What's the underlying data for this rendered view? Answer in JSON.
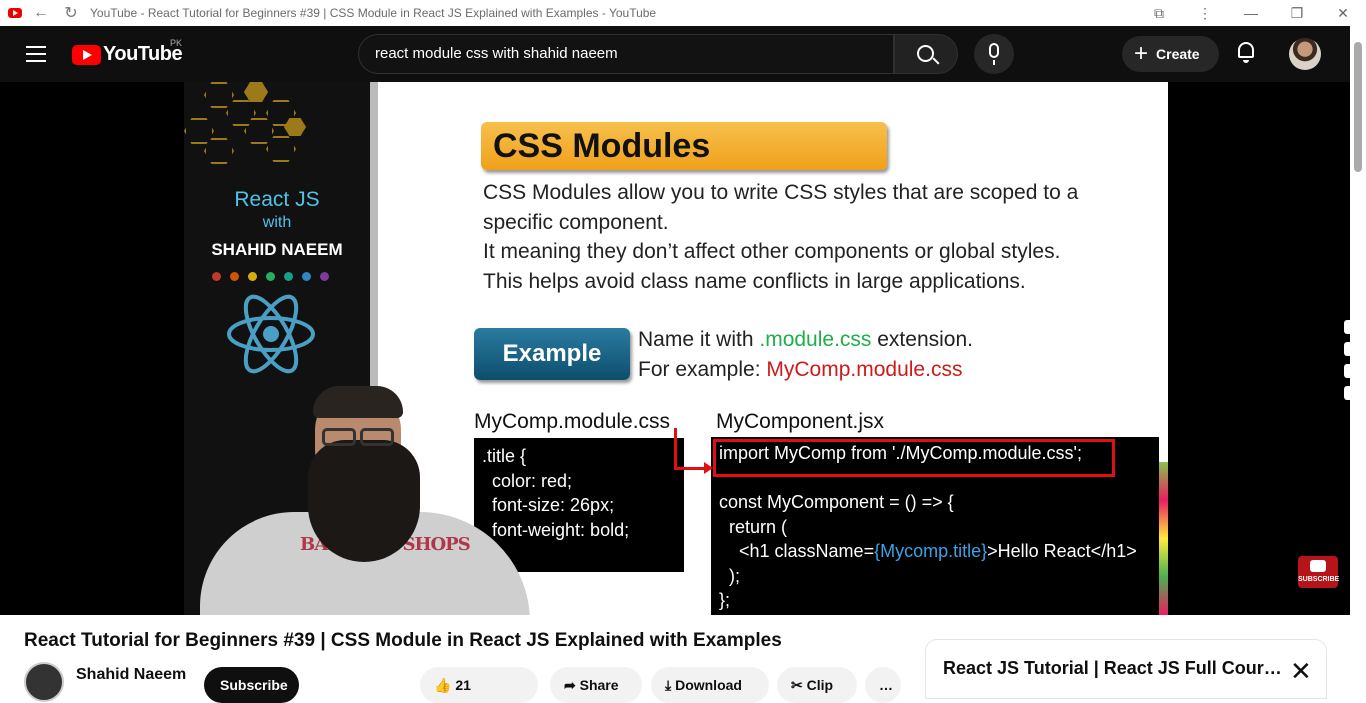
{
  "browser": {
    "tab_title": "YouTube - React Tutorial for Beginners #39 | CSS Module in React JS Explained with Examples - YouTube",
    "back_icon": "←",
    "reload_icon": "↻",
    "extension_icon": "⧉",
    "menu_icon": "⋮",
    "minimize_icon": "—",
    "restore_icon": "❐",
    "close_icon": "✕"
  },
  "masthead": {
    "logo_text": "YouTube",
    "region": "PK",
    "search_value": "react module css with shahid naeem",
    "create_label": "Create",
    "create_plus": "+"
  },
  "slide_left": {
    "title": "React JS",
    "with": "with",
    "name": "SHAHID NAEEM",
    "dot_colors": [
      "#c0392b",
      "#d35400",
      "#d4ac0d",
      "#27ae60",
      "#16a085",
      "#2e86c1",
      "#7d3c98"
    ]
  },
  "slide": {
    "heading": "CSS Modules",
    "paragraph": [
      "CSS Modules allow you to write CSS styles that are scoped to a",
      "specific component.",
      "It meaning they don’t affect other components or global styles.",
      "This helps avoid class name conflicts in large applications."
    ],
    "example_label": "Example",
    "line1_prefix": "Name it with ",
    "line1_highlight": ".module.css",
    "line1_suffix": " extension.",
    "line2_prefix": "For example: ",
    "line2_highlight": "MyComp.module.css",
    "file1_name": "MyComp.module.css",
    "file2_name": "MyComponent.jsx",
    "css_code": [
      ".title {",
      "  color: red;",
      "  font-size: 26px;",
      "  font-weight: bold;",
      "}"
    ],
    "jsx_import": "import MyComp from './MyComp.module.css';",
    "jsx_code_1": "const MyComponent = () => {",
    "jsx_code_2": "  return (",
    "jsx_code_3a": "    <h1 className=",
    "jsx_code_3b": "{Mycomp.title}",
    "jsx_code_3c": ">Hello React</h1>",
    "jsx_code_4": "  );",
    "jsx_code_5": "};"
  },
  "presenter": {
    "shirt_text": "BASS PRO SHOPS"
  },
  "player": {
    "subscribe_badge": "SUBSCRIBE"
  },
  "below": {
    "video_title": "React Tutorial for Beginners #39 | CSS Module in React JS Explained with Examples",
    "channel_name": "Shahid Naeem",
    "subscribe_label": "Subscribe",
    "like_count": "21",
    "share_label": "Share",
    "download_label": "Download",
    "clip_label": "Clip",
    "more_label": "…"
  },
  "playlist": {
    "title": "React JS Tutorial | React JS Full Course",
    "close_icon": "✕"
  }
}
